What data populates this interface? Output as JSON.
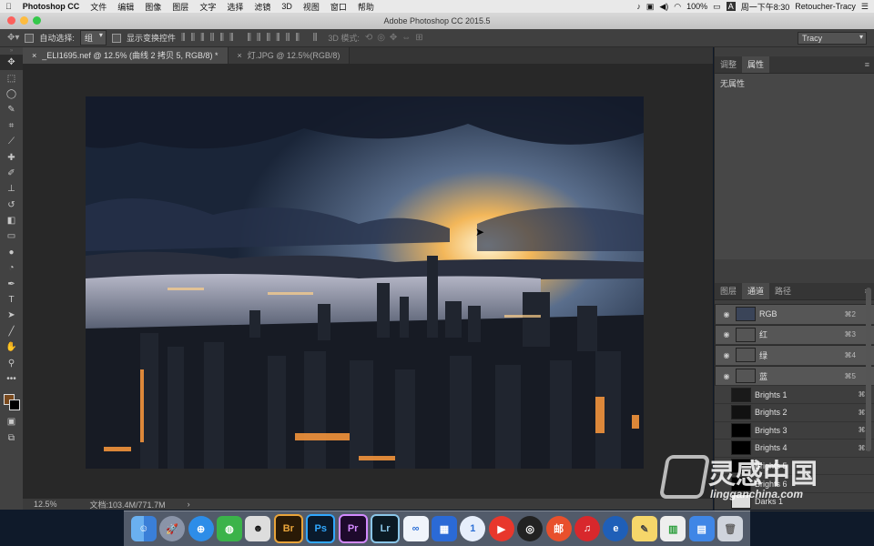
{
  "menubar": {
    "app_name": "Photoshop CC",
    "items": [
      "文件",
      "编辑",
      "图像",
      "图层",
      "文字",
      "选择",
      "滤镜",
      "3D",
      "视图",
      "窗口",
      "帮助"
    ],
    "battery": "100%",
    "clock": "周一下午8:30",
    "user": "Retoucher-Tracy"
  },
  "window": {
    "title": "Adobe Photoshop CC 2015.5"
  },
  "options": {
    "auto_select_label": "自动选择:",
    "auto_select_value": "组",
    "show_transform_label": "显示变换控件",
    "mode_3d_label": "3D 模式:",
    "workspace": "Tracy"
  },
  "tabs": [
    {
      "label": "_ELI1695.nef @ 12.5% (曲线 2 拷贝 5, RGB/8) *"
    },
    {
      "label": "灯.JPG @ 12.5%(RGB/8)"
    }
  ],
  "status": {
    "zoom": "12.5%",
    "doc": "文档:103.4M/771.7M",
    "arrow": "›"
  },
  "properties_panel": {
    "tabs": [
      "调整",
      "属性"
    ],
    "content": "无属性"
  },
  "channels_panel": {
    "tabs": [
      "图层",
      "通道",
      "路径"
    ],
    "channels": [
      {
        "name": "RGB",
        "shortcut": "⌘2"
      },
      {
        "name": "红",
        "shortcut": "⌘3"
      },
      {
        "name": "绿",
        "shortcut": "⌘4"
      },
      {
        "name": "蓝",
        "shortcut": "⌘5"
      },
      {
        "name": "Brights 1",
        "shortcut": "⌘6"
      },
      {
        "name": "Brights 2",
        "shortcut": "⌘7"
      },
      {
        "name": "Brights 3",
        "shortcut": "⌘8"
      },
      {
        "name": "Brights 4",
        "shortcut": "⌘9"
      },
      {
        "name": "Brights 5",
        "shortcut": ""
      },
      {
        "name": "Brights 6",
        "shortcut": ""
      },
      {
        "name": "Darks 1",
        "shortcut": ""
      }
    ]
  },
  "dock": {
    "apps": [
      {
        "icon": "finder-icon",
        "label": ""
      },
      {
        "icon": "launchpad-icon",
        "label": ""
      },
      {
        "icon": "safari-icon",
        "label": ""
      },
      {
        "icon": "wechat-icon",
        "label": ""
      },
      {
        "icon": "qq-icon",
        "label": ""
      },
      {
        "icon": "bridge-icon",
        "label": "Br"
      },
      {
        "icon": "photoshop-icon",
        "label": "Ps"
      },
      {
        "icon": "premiere-icon",
        "label": "Pr"
      },
      {
        "icon": "lightroom-icon",
        "label": "Lr"
      },
      {
        "icon": "baidu-cloud-icon",
        "label": ""
      },
      {
        "icon": "screenshot-icon",
        "label": ""
      },
      {
        "icon": "onepassword-icon",
        "label": ""
      },
      {
        "icon": "video-player-icon",
        "label": ""
      },
      {
        "icon": "obs-icon",
        "label": ""
      },
      {
        "icon": "mail-icon",
        "label": ""
      },
      {
        "icon": "netease-music-icon",
        "label": ""
      },
      {
        "icon": "browser-icon",
        "label": ""
      },
      {
        "icon": "notes-icon",
        "label": ""
      },
      {
        "icon": "numbers-icon",
        "label": ""
      },
      {
        "icon": "keynote-icon",
        "label": ""
      },
      {
        "icon": "trash-icon",
        "label": ""
      }
    ]
  },
  "watermark": {
    "brand": "灵感中国",
    "url": "lingganchina.com"
  },
  "colors": {
    "accent": "#2c6fd6",
    "panel_bg": "#3e3e3e",
    "canvas_bg": "#282828"
  }
}
